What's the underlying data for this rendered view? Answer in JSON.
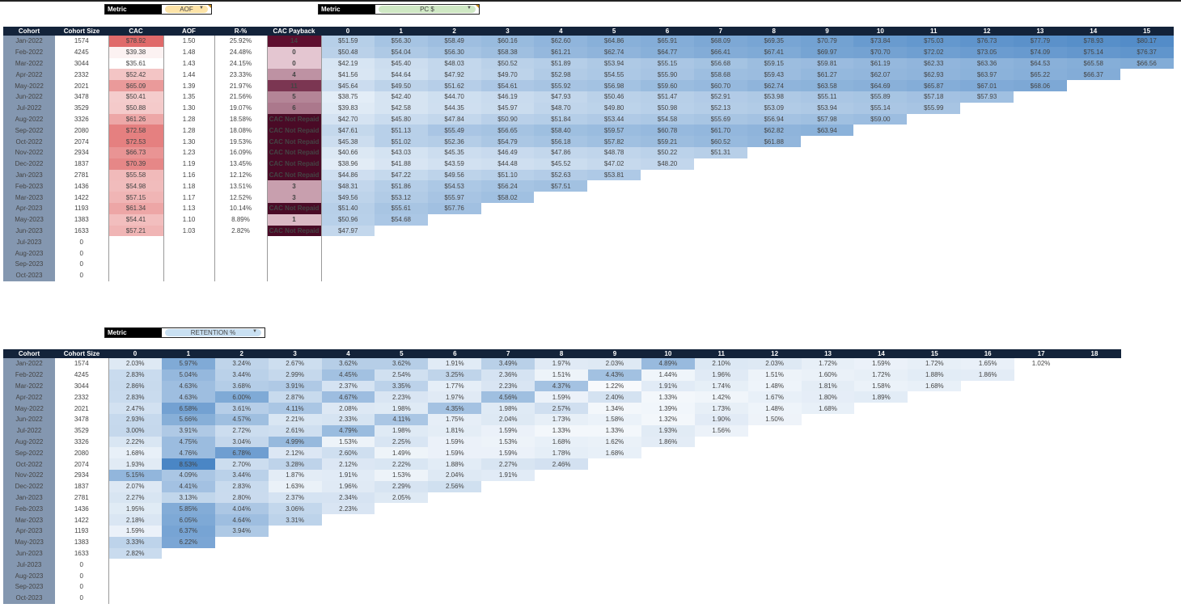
{
  "top": {
    "metric_left": {
      "label": "Metric",
      "value": "AOF",
      "bg": "#fde3a7"
    },
    "metric_right": {
      "label": "Metric",
      "value": "PC $",
      "bg": "#cfe8c4"
    },
    "headers": [
      "Cohort",
      "Cohort Size",
      "CAC",
      "AOF",
      "R-%",
      "CAC Payback",
      "0",
      "1",
      "2",
      "3",
      "4",
      "5",
      "6",
      "7",
      "8",
      "9",
      "10",
      "11",
      "12",
      "13",
      "14",
      "15"
    ],
    "rows": [
      {
        "cohort": "Jan-2022",
        "size": "1574",
        "cac": "$78.92",
        "aof": "1.50",
        "r": "25.92%",
        "payback": "14",
        "pc": [
          "$51.59",
          "$56.30",
          "$58.49",
          "$60.16",
          "$62.60",
          "$64.86",
          "$65.91",
          "$68.09",
          "$69.35",
          "$70.79",
          "$73.84",
          "$75.03",
          "$76.73",
          "$77.79",
          "$78.93",
          "$80.17"
        ]
      },
      {
        "cohort": "Feb-2022",
        "size": "4245",
        "cac": "$39.38",
        "aof": "1.48",
        "r": "24.48%",
        "payback": "0",
        "pc": [
          "$50.48",
          "$54.04",
          "$56.30",
          "$58.38",
          "$61.21",
          "$62.74",
          "$64.77",
          "$66.41",
          "$67.41",
          "$69.97",
          "$70.70",
          "$72.02",
          "$73.05",
          "$74.09",
          "$75.14",
          "$76.37"
        ]
      },
      {
        "cohort": "Mar-2022",
        "size": "3044",
        "cac": "$35.61",
        "aof": "1.43",
        "r": "24.15%",
        "payback": "0",
        "pc": [
          "$42.19",
          "$45.40",
          "$48.03",
          "$50.52",
          "$51.89",
          "$53.94",
          "$55.15",
          "$56.68",
          "$59.15",
          "$59.81",
          "$61.19",
          "$62.33",
          "$63.36",
          "$64.53",
          "$65.58",
          "$66.56"
        ]
      },
      {
        "cohort": "Apr-2022",
        "size": "2332",
        "cac": "$52.42",
        "aof": "1.44",
        "r": "23.33%",
        "payback": "4",
        "pc": [
          "$41.56",
          "$44.64",
          "$47.92",
          "$49.70",
          "$52.98",
          "$54.55",
          "$55.90",
          "$58.68",
          "$59.43",
          "$61.27",
          "$62.07",
          "$62.93",
          "$63.97",
          "$65.22",
          "$66.37"
        ]
      },
      {
        "cohort": "May-2022",
        "size": "2021",
        "cac": "$65.09",
        "aof": "1.39",
        "r": "21.97%",
        "payback": "11",
        "pc": [
          "$45.64",
          "$49.50",
          "$51.62",
          "$54.61",
          "$55.92",
          "$56.98",
          "$59.60",
          "$60.70",
          "$62.74",
          "$63.58",
          "$64.69",
          "$65.87",
          "$67.01",
          "$68.06"
        ]
      },
      {
        "cohort": "Jun-2022",
        "size": "3478",
        "cac": "$50.41",
        "aof": "1.35",
        "r": "21.56%",
        "payback": "5",
        "pc": [
          "$38.75",
          "$42.40",
          "$44.70",
          "$46.19",
          "$47.93",
          "$50.46",
          "$51.47",
          "$52.91",
          "$53.98",
          "$55.11",
          "$55.89",
          "$57.18",
          "$57.93"
        ]
      },
      {
        "cohort": "Jul-2022",
        "size": "3529",
        "cac": "$50.88",
        "aof": "1.30",
        "r": "19.07%",
        "payback": "6",
        "pc": [
          "$39.83",
          "$42.58",
          "$44.35",
          "$45.97",
          "$48.70",
          "$49.80",
          "$50.98",
          "$52.13",
          "$53.09",
          "$53.94",
          "$55.14",
          "$55.99"
        ]
      },
      {
        "cohort": "Aug-2022",
        "size": "3326",
        "cac": "$61.26",
        "aof": "1.28",
        "r": "18.58%",
        "payback": "CAC Not Repaid",
        "pc": [
          "$42.70",
          "$45.80",
          "$47.84",
          "$50.90",
          "$51.84",
          "$53.44",
          "$54.58",
          "$55.69",
          "$56.94",
          "$57.98",
          "$59.00"
        ]
      },
      {
        "cohort": "Sep-2022",
        "size": "2080",
        "cac": "$72.58",
        "aof": "1.28",
        "r": "18.08%",
        "payback": "CAC Not Repaid",
        "pc": [
          "$47.61",
          "$51.13",
          "$55.49",
          "$56.65",
          "$58.40",
          "$59.57",
          "$60.78",
          "$61.70",
          "$62.82",
          "$63.94"
        ]
      },
      {
        "cohort": "Oct-2022",
        "size": "2074",
        "cac": "$72.53",
        "aof": "1.30",
        "r": "19.53%",
        "payback": "CAC Not Repaid",
        "pc": [
          "$45.38",
          "$51.02",
          "$52.36",
          "$54.79",
          "$56.18",
          "$57.82",
          "$59.21",
          "$60.52",
          "$61.88"
        ]
      },
      {
        "cohort": "Nov-2022",
        "size": "2934",
        "cac": "$66.73",
        "aof": "1.23",
        "r": "16.09%",
        "payback": "CAC Not Repaid",
        "pc": [
          "$40.66",
          "$43.03",
          "$45.35",
          "$46.49",
          "$47.86",
          "$48.78",
          "$50.22",
          "$51.31"
        ]
      },
      {
        "cohort": "Dec-2022",
        "size": "1837",
        "cac": "$70.39",
        "aof": "1.19",
        "r": "13.45%",
        "payback": "CAC Not Repaid",
        "pc": [
          "$38.96",
          "$41.88",
          "$43.59",
          "$44.48",
          "$45.52",
          "$47.02",
          "$48.20"
        ]
      },
      {
        "cohort": "Jan-2023",
        "size": "2781",
        "cac": "$55.58",
        "aof": "1.16",
        "r": "12.12%",
        "payback": "CAC Not Repaid",
        "pc": [
          "$44.86",
          "$47.22",
          "$49.56",
          "$51.10",
          "$52.63",
          "$53.81"
        ]
      },
      {
        "cohort": "Feb-2023",
        "size": "1436",
        "cac": "$54.98",
        "aof": "1.18",
        "r": "13.51%",
        "payback": "3",
        "pc": [
          "$48.31",
          "$51.86",
          "$54.53",
          "$56.24",
          "$57.51"
        ]
      },
      {
        "cohort": "Mar-2023",
        "size": "1422",
        "cac": "$57.15",
        "aof": "1.17",
        "r": "12.52%",
        "payback": "3",
        "pc": [
          "$49.56",
          "$53.12",
          "$55.97",
          "$58.02"
        ]
      },
      {
        "cohort": "Apr-2023",
        "size": "1193",
        "cac": "$61.34",
        "aof": "1.13",
        "r": "10.14%",
        "payback": "CAC Not Repaid",
        "pc": [
          "$51.40",
          "$55.61",
          "$57.76"
        ]
      },
      {
        "cohort": "May-2023",
        "size": "1383",
        "cac": "$54.41",
        "aof": "1.10",
        "r": "8.89%",
        "payback": "1",
        "pc": [
          "$50.96",
          "$54.68"
        ]
      },
      {
        "cohort": "Jun-2023",
        "size": "1633",
        "cac": "$57.21",
        "aof": "1.03",
        "r": "2.82%",
        "payback": "CAC Not Repaid",
        "pc": [
          "$47.97"
        ]
      },
      {
        "cohort": "Jul-2023",
        "size": "0",
        "cac": "",
        "aof": "",
        "r": "",
        "payback": "",
        "pc": []
      },
      {
        "cohort": "Aug-2023",
        "size": "0",
        "cac": "",
        "aof": "",
        "r": "",
        "payback": "",
        "pc": []
      },
      {
        "cohort": "Sep-2023",
        "size": "0",
        "cac": "",
        "aof": "",
        "r": "",
        "payback": "",
        "pc": []
      },
      {
        "cohort": "Oct-2023",
        "size": "0",
        "cac": "",
        "aof": "",
        "r": "",
        "payback": "",
        "pc": []
      }
    ]
  },
  "bottom": {
    "metric": {
      "label": "Metric",
      "value": "RETENTION %",
      "bg": "#c9e0f2"
    },
    "headers": [
      "Cohort",
      "Cohort Size",
      "0",
      "1",
      "2",
      "3",
      "4",
      "5",
      "6",
      "7",
      "8",
      "9",
      "10",
      "11",
      "12",
      "13",
      "14",
      "15",
      "16",
      "17",
      "18"
    ],
    "rows": [
      {
        "cohort": "Jan-2022",
        "size": "1574",
        "ret": [
          "2.03%",
          "5.97%",
          "3.24%",
          "2.67%",
          "3.62%",
          "3.62%",
          "1.91%",
          "3.49%",
          "1.97%",
          "2.03%",
          "4.89%",
          "2.10%",
          "2.03%",
          "1.72%",
          "1.59%",
          "1.72%",
          "1.65%",
          "1.02%"
        ]
      },
      {
        "cohort": "Feb-2022",
        "size": "4245",
        "ret": [
          "2.83%",
          "5.04%",
          "3.44%",
          "2.99%",
          "4.45%",
          "2.54%",
          "3.25%",
          "2.36%",
          "1.51%",
          "4.43%",
          "1.44%",
          "1.96%",
          "1.51%",
          "1.60%",
          "1.72%",
          "1.88%",
          "1.86%"
        ]
      },
      {
        "cohort": "Mar-2022",
        "size": "3044",
        "ret": [
          "2.86%",
          "4.63%",
          "3.68%",
          "3.91%",
          "2.37%",
          "3.35%",
          "1.77%",
          "2.23%",
          "4.37%",
          "1.22%",
          "1.91%",
          "1.74%",
          "1.48%",
          "1.81%",
          "1.58%",
          "1.68%"
        ]
      },
      {
        "cohort": "Apr-2022",
        "size": "2332",
        "ret": [
          "2.83%",
          "4.63%",
          "6.00%",
          "2.87%",
          "4.67%",
          "2.23%",
          "1.97%",
          "4.56%",
          "1.59%",
          "2.40%",
          "1.33%",
          "1.42%",
          "1.67%",
          "1.80%",
          "1.89%"
        ]
      },
      {
        "cohort": "May-2022",
        "size": "2021",
        "ret": [
          "2.47%",
          "6.58%",
          "3.61%",
          "4.11%",
          "2.08%",
          "1.98%",
          "4.35%",
          "1.98%",
          "2.57%",
          "1.34%",
          "1.39%",
          "1.73%",
          "1.48%",
          "1.68%"
        ]
      },
      {
        "cohort": "Jun-2022",
        "size": "3478",
        "ret": [
          "2.93%",
          "5.66%",
          "4.57%",
          "2.21%",
          "2.33%",
          "4.11%",
          "1.75%",
          "2.04%",
          "1.73%",
          "1.58%",
          "1.32%",
          "1.90%",
          "1.50%"
        ]
      },
      {
        "cohort": "Jul-2022",
        "size": "3529",
        "ret": [
          "3.00%",
          "3.91%",
          "2.72%",
          "2.61%",
          "4.79%",
          "1.98%",
          "1.81%",
          "1.59%",
          "1.33%",
          "1.33%",
          "1.93%",
          "1.56%"
        ]
      },
      {
        "cohort": "Aug-2022",
        "size": "3326",
        "ret": [
          "2.22%",
          "4.75%",
          "3.04%",
          "4.99%",
          "1.53%",
          "2.25%",
          "1.59%",
          "1.53%",
          "1.68%",
          "1.62%",
          "1.86%"
        ]
      },
      {
        "cohort": "Sep-2022",
        "size": "2080",
        "ret": [
          "1.68%",
          "4.76%",
          "6.78%",
          "2.12%",
          "2.60%",
          "1.49%",
          "1.59%",
          "1.59%",
          "1.78%",
          "1.68%"
        ]
      },
      {
        "cohort": "Oct-2022",
        "size": "2074",
        "ret": [
          "1.93%",
          "8.53%",
          "2.70%",
          "3.28%",
          "2.12%",
          "2.22%",
          "1.88%",
          "2.27%",
          "2.46%"
        ]
      },
      {
        "cohort": "Nov-2022",
        "size": "2934",
        "ret": [
          "5.15%",
          "4.09%",
          "3.44%",
          "1.87%",
          "1.91%",
          "1.53%",
          "2.04%",
          "1.91%"
        ]
      },
      {
        "cohort": "Dec-2022",
        "size": "1837",
        "ret": [
          "2.07%",
          "4.41%",
          "2.83%",
          "1.63%",
          "1.96%",
          "2.29%",
          "2.56%"
        ]
      },
      {
        "cohort": "Jan-2023",
        "size": "2781",
        "ret": [
          "2.27%",
          "3.13%",
          "2.80%",
          "2.37%",
          "2.34%",
          "2.05%"
        ]
      },
      {
        "cohort": "Feb-2023",
        "size": "1436",
        "ret": [
          "1.95%",
          "5.85%",
          "4.04%",
          "3.06%",
          "2.23%"
        ]
      },
      {
        "cohort": "Mar-2023",
        "size": "1422",
        "ret": [
          "2.18%",
          "6.05%",
          "4.64%",
          "3.31%"
        ]
      },
      {
        "cohort": "Apr-2023",
        "size": "1193",
        "ret": [
          "1.59%",
          "6.37%",
          "3.94%"
        ]
      },
      {
        "cohort": "May-2023",
        "size": "1383",
        "ret": [
          "3.33%",
          "6.22%"
        ]
      },
      {
        "cohort": "Jun-2023",
        "size": "1633",
        "ret": [
          "2.82%"
        ]
      },
      {
        "cohort": "Jul-2023",
        "size": "0",
        "ret": []
      },
      {
        "cohort": "Aug-2023",
        "size": "0",
        "ret": []
      },
      {
        "cohort": "Sep-2023",
        "size": "0",
        "ret": []
      },
      {
        "cohort": "Oct-2023",
        "size": "0",
        "ret": []
      }
    ]
  },
  "colors": {
    "header_bg": "#13233a",
    "cohort_bg": "#8497b0",
    "cac_low": "#ffffff",
    "cac_high": "#e06a6a",
    "payback_low": "#f0d6df",
    "payback_high": "#5e0f2f",
    "heat_low": "#ffffff",
    "heat_high": "#4a86c5"
  }
}
